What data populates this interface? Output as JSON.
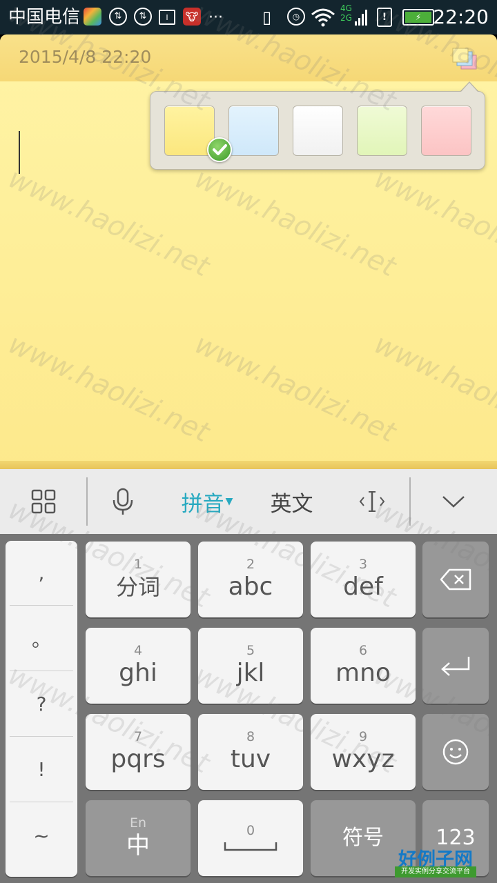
{
  "status_bar": {
    "carrier": "中国电信",
    "clock": "22:20",
    "network": "4G 2G",
    "icons": [
      "app-icon",
      "sync-icon",
      "sync-icon",
      "sim-icon",
      "app-icon",
      "more-icon",
      "vibrate-icon",
      "alarm-icon",
      "wifi-icon",
      "signal-icon",
      "sim-alert-icon",
      "battery-charging-icon"
    ]
  },
  "note": {
    "date": "2015/4/8 22:20",
    "background": "#fff4a6",
    "colors": [
      {
        "name": "yellow",
        "hex": "#fbe77e",
        "selected": true
      },
      {
        "name": "blue",
        "hex": "#d6ecfb",
        "selected": false
      },
      {
        "name": "white",
        "hex": "#fafafa",
        "selected": false
      },
      {
        "name": "green",
        "hex": "#e6f8c2",
        "selected": false
      },
      {
        "name": "pink",
        "hex": "#fccccc",
        "selected": false
      }
    ]
  },
  "ime_toolbar": {
    "pinyin": "拼音",
    "english": "英文",
    "accent": "#27a9c0",
    "icons": [
      "grid-icon",
      "microphone-icon",
      "cursor-move-icon",
      "collapse-keyboard-icon"
    ]
  },
  "keyboard": {
    "punctuation": [
      ",",
      "。",
      "?",
      "!",
      "~"
    ],
    "keys": [
      {
        "num": "1",
        "label": "分词"
      },
      {
        "num": "2",
        "label": "abc"
      },
      {
        "num": "3",
        "label": "def"
      },
      {
        "num": "4",
        "label": "ghi"
      },
      {
        "num": "5",
        "label": "jkl"
      },
      {
        "num": "6",
        "label": "mno"
      },
      {
        "num": "7",
        "label": "pqrs"
      },
      {
        "num": "8",
        "label": "tuv"
      },
      {
        "num": "9",
        "label": "wxyz"
      }
    ],
    "lang_key": {
      "small": "En",
      "label": "中"
    },
    "space_key": {
      "num": "0"
    },
    "symbol_key": "符号",
    "num_key": "123"
  },
  "watermark": "www.haolizi.net",
  "brand": {
    "main": "好例子网",
    "sub": "开发实例分享交流平台"
  }
}
